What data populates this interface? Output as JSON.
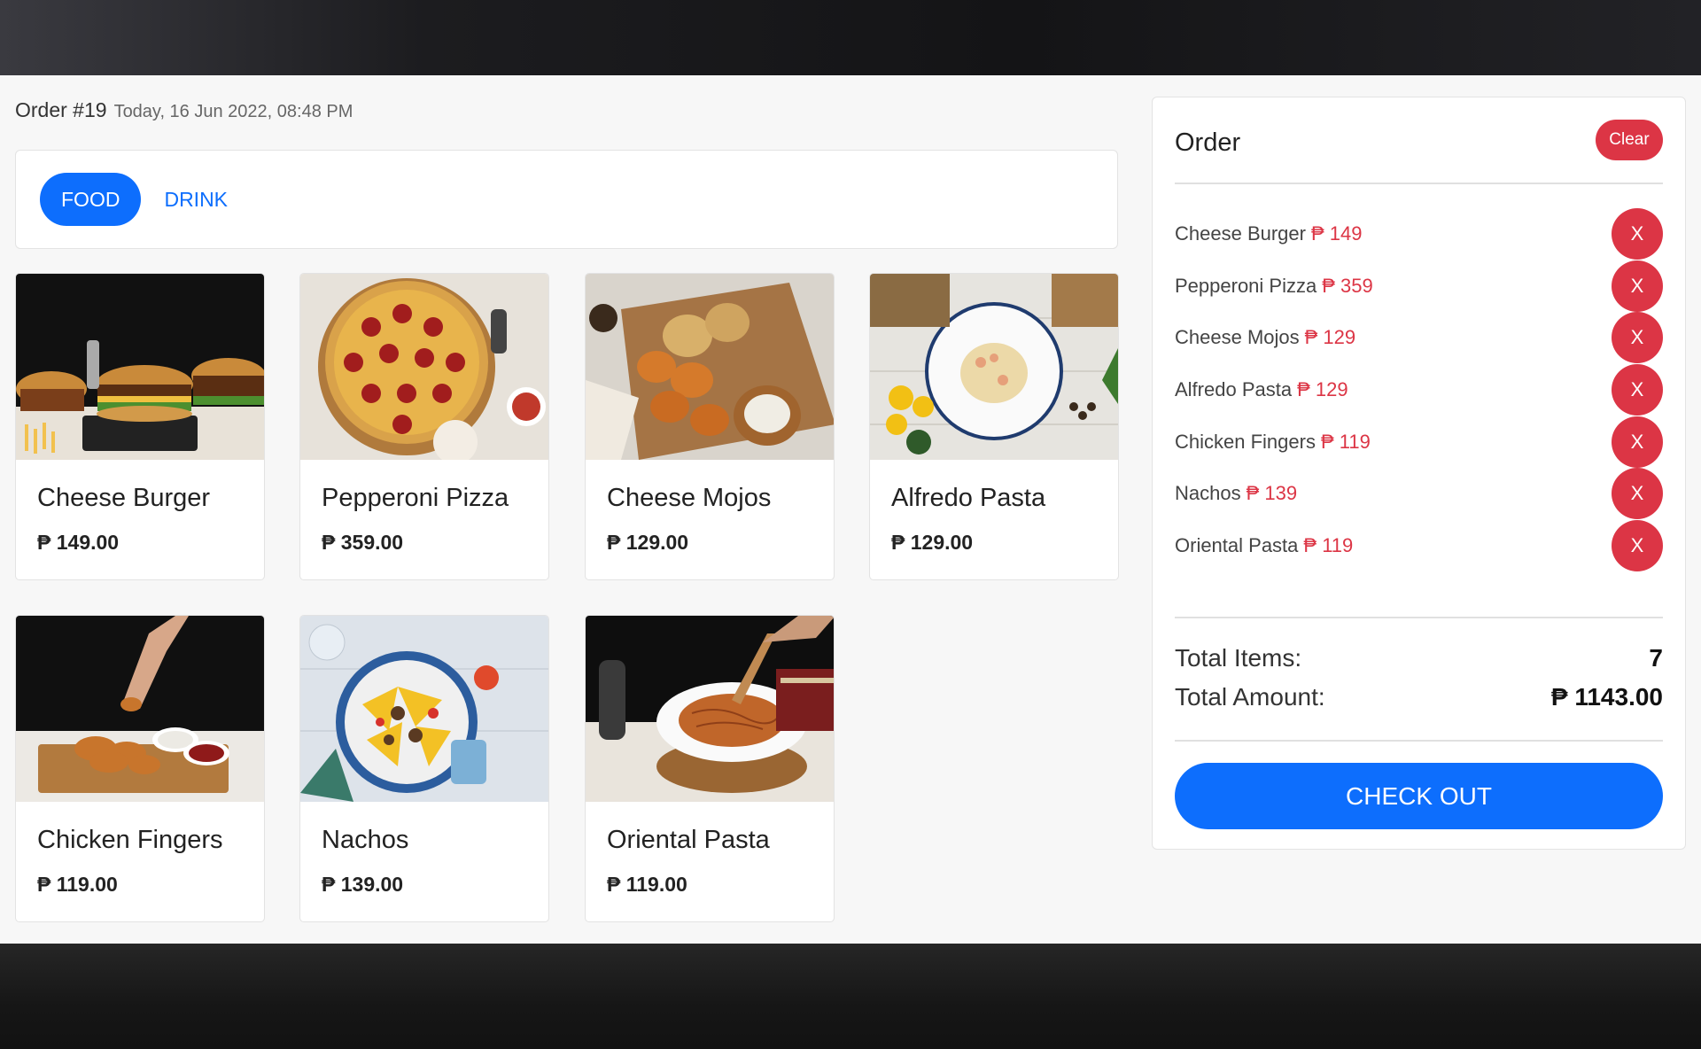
{
  "header": {
    "order_number": "Order #19",
    "order_date": "Today, 16 Jun 2022, 08:48 PM"
  },
  "tabs": [
    {
      "label": "FOOD",
      "active": true
    },
    {
      "label": "DRINK",
      "active": false
    }
  ],
  "products": [
    {
      "name": "Cheese Burger",
      "price": "₱ 149.00",
      "image": "cheese-burger-photo"
    },
    {
      "name": "Pepperoni Pizza",
      "price": "₱ 359.00",
      "image": "pepperoni-pizza-photo"
    },
    {
      "name": "Cheese Mojos",
      "price": "₱ 129.00",
      "image": "cheese-mojos-photo"
    },
    {
      "name": "Alfredo Pasta",
      "price": "₱ 129.00",
      "image": "alfredo-pasta-photo"
    },
    {
      "name": "Chicken Fingers",
      "price": "₱ 119.00",
      "image": "chicken-fingers-photo"
    },
    {
      "name": "Nachos",
      "price": "₱ 139.00",
      "image": "nachos-photo"
    },
    {
      "name": "Oriental Pasta",
      "price": "₱ 119.00",
      "image": "oriental-pasta-photo"
    }
  ],
  "order": {
    "title": "Order",
    "clear_label": "Clear",
    "items": [
      {
        "name": "Cheese Burger",
        "amount": "₱ 149",
        "remove_label": "X"
      },
      {
        "name": "Pepperoni Pizza",
        "amount": "₱ 359",
        "remove_label": "X"
      },
      {
        "name": "Cheese Mojos",
        "amount": "₱ 129",
        "remove_label": "X"
      },
      {
        "name": "Alfredo Pasta",
        "amount": "₱ 129",
        "remove_label": "X"
      },
      {
        "name": "Chicken Fingers",
        "amount": "₱ 119",
        "remove_label": "X"
      },
      {
        "name": "Nachos",
        "amount": "₱ 139",
        "remove_label": "X"
      },
      {
        "name": "Oriental Pasta",
        "amount": "₱ 119",
        "remove_label": "X"
      }
    ],
    "total_items_label": "Total Items:",
    "total_items_value": "7",
    "total_amount_label": "Total Amount:",
    "total_amount_value": "₱ 1143.00",
    "checkout_label": "CHECK OUT"
  },
  "colors": {
    "primary": "#0d6efd",
    "danger": "#dc3545"
  }
}
